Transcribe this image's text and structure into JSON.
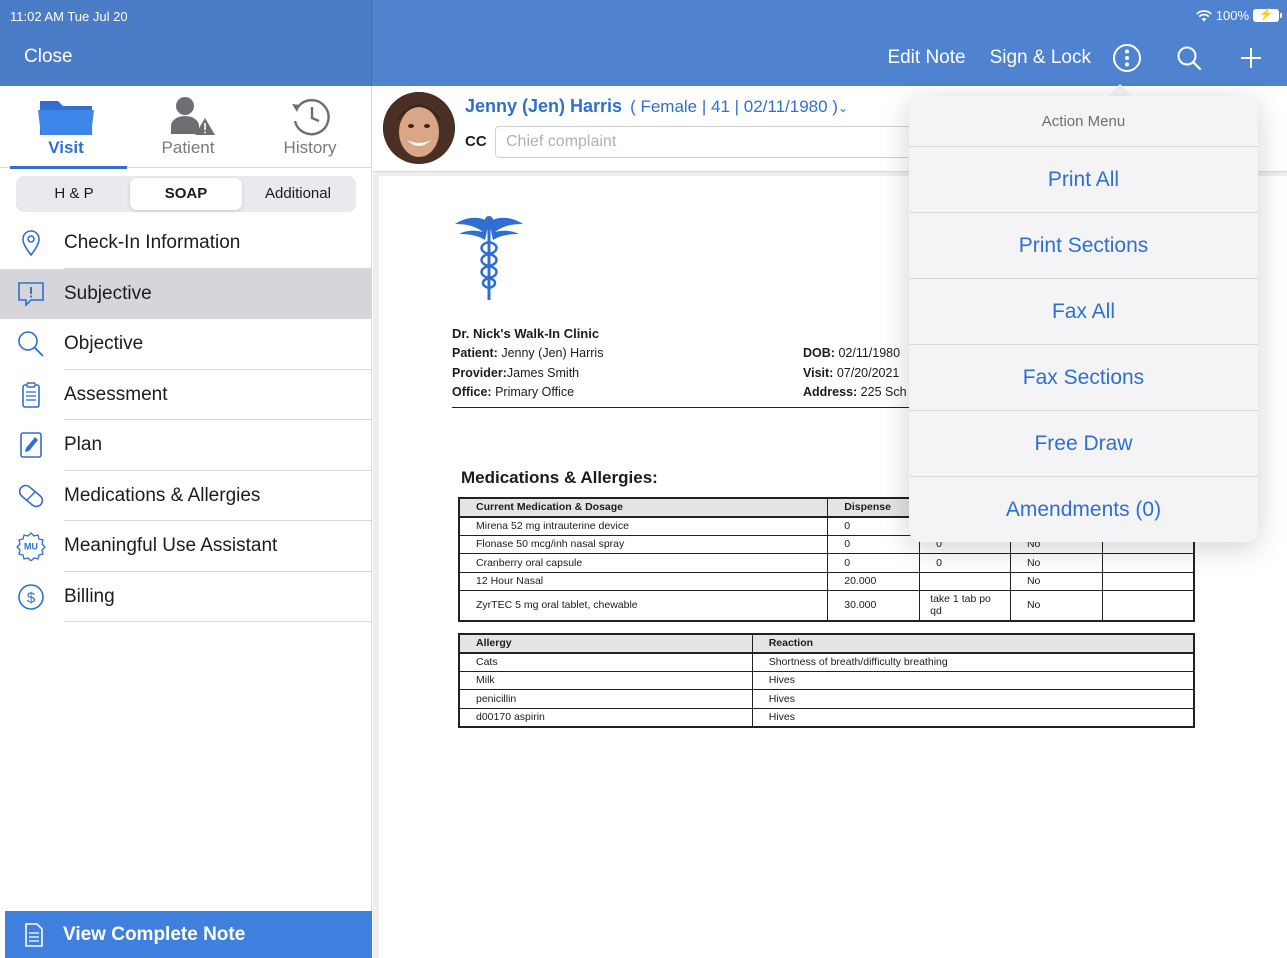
{
  "status_bar": {
    "time": "11:02 AM  Tue Jul 20",
    "battery": "100%"
  },
  "toolbar": {
    "close_label": "Close",
    "edit_note_label": "Edit Note",
    "sign_lock_label": "Sign & Lock",
    "icons": [
      "more-icon",
      "search-icon",
      "plus-icon"
    ]
  },
  "sidebar": {
    "tabs": [
      {
        "label": "Visit",
        "icon": "folder-icon",
        "active": true
      },
      {
        "label": "Patient",
        "icon": "patient-warning-icon",
        "active": false
      },
      {
        "label": "History",
        "icon": "history-icon",
        "active": false
      }
    ],
    "segments": [
      {
        "label": "H & P",
        "active": false
      },
      {
        "label": "SOAP",
        "active": true
      },
      {
        "label": "Additional",
        "active": false
      }
    ],
    "items": [
      {
        "label": "Check-In Information",
        "icon": "location-pin-icon"
      },
      {
        "label": "Subjective",
        "icon": "speech-alert-icon",
        "selected": true
      },
      {
        "label": "Objective",
        "icon": "magnifier-icon"
      },
      {
        "label": "Assessment",
        "icon": "clipboard-icon"
      },
      {
        "label": "Plan",
        "icon": "pen-icon"
      },
      {
        "label": "Medications & Allergies",
        "icon": "pill-icon"
      },
      {
        "label": "Meaningful Use Assistant",
        "icon": "mu-badge-icon"
      },
      {
        "label": "Billing",
        "icon": "dollar-icon"
      }
    ],
    "view_note_label": "View Complete Note"
  },
  "patient": {
    "name": "Jenny (Jen) Harris",
    "demographics": "( Female | 41 | 02/11/1980 )",
    "cc_label": "CC",
    "cc_placeholder": "Chief complaint"
  },
  "document": {
    "clinic": "Dr. Nick's Walk-In Clinic",
    "patient_label": "Patient:",
    "patient_value": "Jenny (Jen) Harris",
    "provider_label": "Provider:",
    "provider_value": "James Smith",
    "office_label": "Office:",
    "office_value": "Primary Office",
    "dob_label": "DOB:",
    "dob_value": "02/11/1980",
    "visit_label": "Visit:",
    "visit_value": "07/20/2021",
    "address_label": "Address:",
    "address_value": "225 Sch",
    "section_title": "Medications & Allergies:",
    "med_headers": [
      "Current Medication & Dosage",
      "Dispense",
      "",
      "",
      ""
    ],
    "med_rows": [
      [
        "Mirena 52 mg intrauterine device",
        "0",
        "",
        "",
        ""
      ],
      [
        "Flonase 50 mcg/inh nasal spray",
        "0",
        "0",
        "No",
        ""
      ],
      [
        "Cranberry oral capsule",
        "0",
        "0",
        "No",
        ""
      ],
      [
        "12 Hour Nasal",
        "20.000",
        "",
        "No",
        ""
      ],
      [
        "ZyrTEC 5 mg oral tablet, chewable",
        "30.000",
        "take 1 tab po qd",
        "No",
        ""
      ]
    ],
    "allergy_headers": [
      "Allergy",
      "Reaction"
    ],
    "allergy_rows": [
      [
        "Cats",
        "Shortness of breath/difficulty breathing"
      ],
      [
        "Milk",
        "Hives"
      ],
      [
        "penicillin",
        "Hives"
      ],
      [
        "d00170 aspirin",
        "Hives"
      ]
    ]
  },
  "action_menu": {
    "title": "Action Menu",
    "items": [
      "Print All",
      "Print Sections",
      "Fax All",
      "Fax Sections",
      "Free Draw",
      "Amendments (0)"
    ]
  },
  "colors": {
    "accent": "#2f6fd0",
    "header": "#4f82cf",
    "view_note": "#3f80df"
  }
}
